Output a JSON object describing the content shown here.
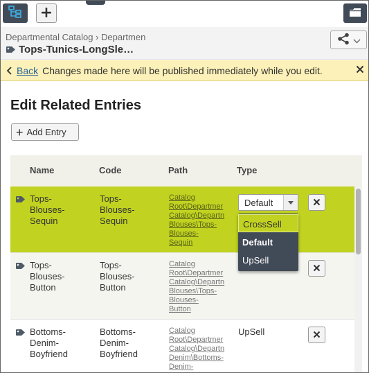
{
  "toolbar": {
    "tree_icon": "tree-view-icon",
    "add_label": "+",
    "folder_icon": "folder-icon"
  },
  "header": {
    "breadcrumb": "Departmental Catalog › Departmen",
    "title": "Tops-Tunics-LongSle…",
    "share_icon": "share-icon"
  },
  "notification": {
    "back_label": "Back",
    "message": "Changes made here will be published immediately while you edit.",
    "color": "#fcf1b8"
  },
  "page": {
    "title": "Edit Related Entries",
    "add_entry_label": "Add Entry"
  },
  "table": {
    "columns": [
      "Name",
      "Code",
      "Path",
      "Type"
    ],
    "rows": [
      {
        "name": "Tops-\nBlouses-\nSequin",
        "code": "Tops-\nBlouses-\nSequin",
        "path": "Catalog\nRoot\\Departmer\nCatalog\\Departn\nBlouses\\Tops-\nBlouses-\nSequin",
        "type": "Default"
      },
      {
        "name": "Tops-\nBlouses-\nButton",
        "code": "Tops-\nBlouses-\nButton",
        "path": "Catalog\nRoot\\Departmer\nCatalog\\Departn\nBlouses\\Tops-\nBlouses-\nButton",
        "type": ""
      },
      {
        "name": "Bottoms-\nDenim-\nBoyfriend",
        "code": "Bottoms-\nDenim-\nBoyfriend",
        "path": "Catalog\nRoot\\Departmer\nCatalog\\Departn\nDenim\\Bottoms-\nDenim-",
        "type": "UpSell"
      }
    ],
    "selected_color": "#c1d320"
  },
  "type_select": {
    "value": "Default",
    "options": [
      "CrossSell",
      "Default",
      "UpSell"
    ]
  }
}
